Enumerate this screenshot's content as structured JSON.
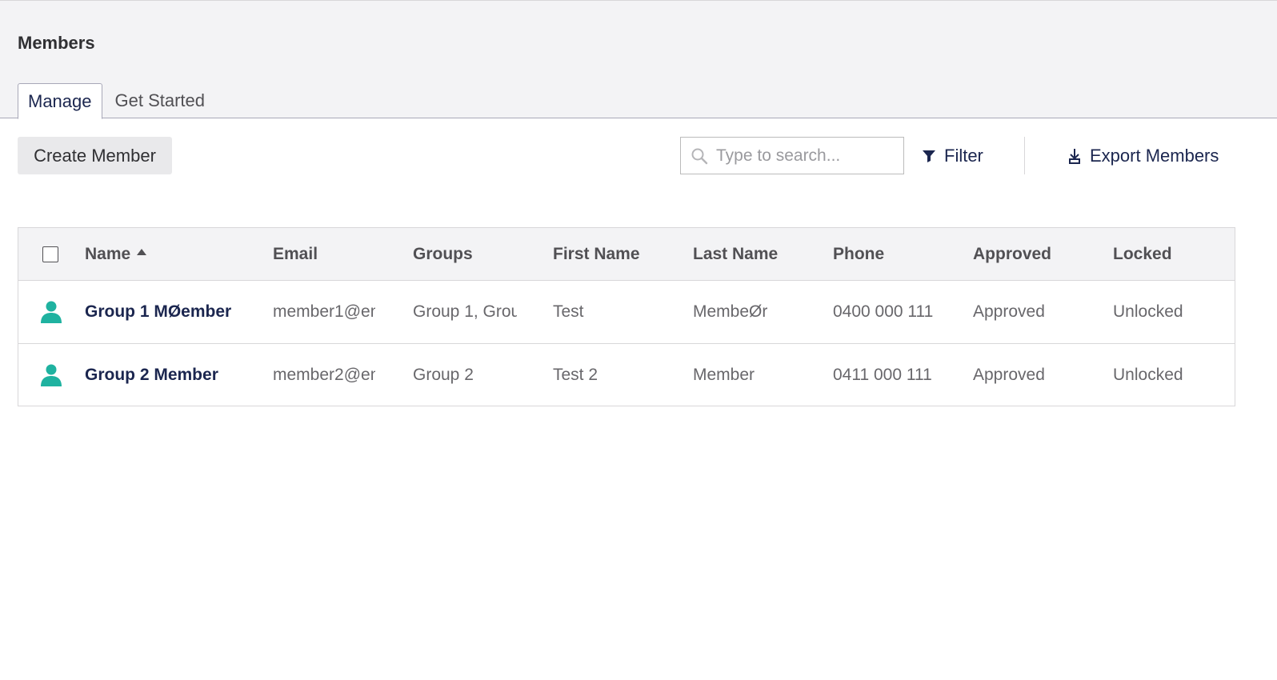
{
  "header": {
    "title": "Members",
    "tabs": [
      {
        "label": "Manage",
        "active": true
      },
      {
        "label": "Get Started",
        "active": false
      }
    ]
  },
  "toolbar": {
    "create_label": "Create Member",
    "search_placeholder": "Type to search...",
    "search_value": "",
    "filter_label": "Filter",
    "export_label": "Export Members"
  },
  "table": {
    "columns": [
      "Name",
      "Email",
      "Groups",
      "First Name",
      "Last Name",
      "Phone",
      "Approved",
      "Locked"
    ],
    "sort": {
      "column": "Name",
      "direction": "ascending"
    },
    "rows": [
      {
        "icon": "member-icon",
        "name": "Group 1 MØember",
        "email": "member1@em",
        "groups": "Group 1, Grou",
        "first_name": "Test",
        "last_name": "MembeØr",
        "phone": "0400 000 111",
        "approved": "Approved",
        "locked": "Unlocked"
      },
      {
        "icon": "member-icon",
        "name": "Group 2 Member",
        "email": "member2@em",
        "groups": "Group 2",
        "first_name": "Test 2",
        "last_name": "Member",
        "phone": "0411 000 111",
        "approved": "Approved",
        "locked": "Unlocked"
      }
    ]
  },
  "colors": {
    "member_icon": "#1fb2a0",
    "header_bg": "#f3f3f5",
    "text_primary": "#1b264f"
  }
}
